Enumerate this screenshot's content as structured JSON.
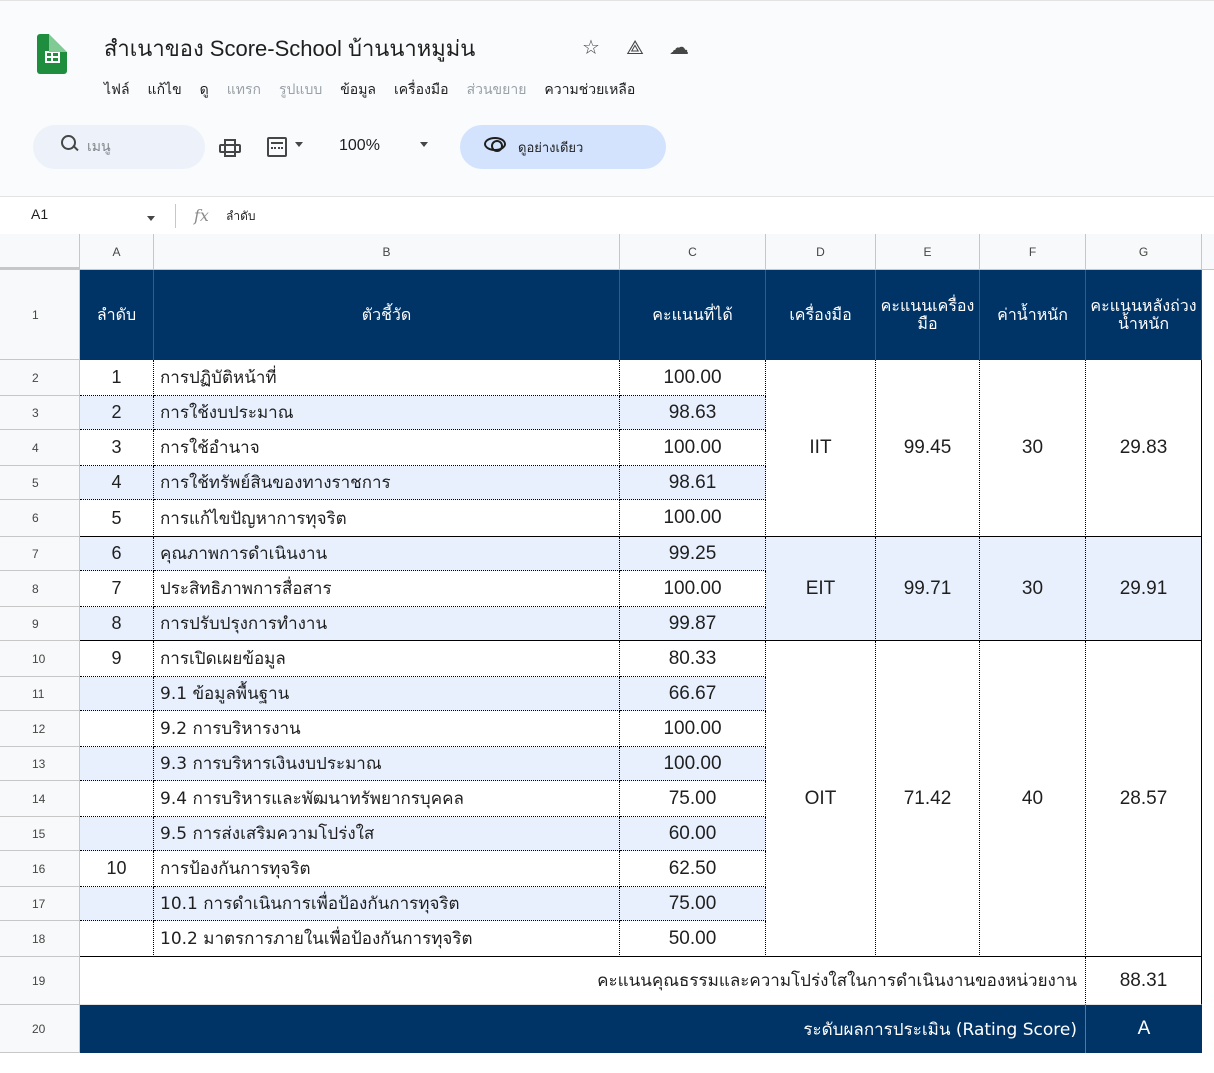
{
  "app": {
    "title": "สำเนาของ Score-School บ้านนาหมูม่น",
    "menu": [
      {
        "label": "ไฟล์",
        "enabled": true
      },
      {
        "label": "แก้ไข",
        "enabled": true
      },
      {
        "label": "ดู",
        "enabled": true
      },
      {
        "label": "แทรก",
        "enabled": false
      },
      {
        "label": "รูปแบบ",
        "enabled": false
      },
      {
        "label": "ข้อมูล",
        "enabled": true
      },
      {
        "label": "เครื่องมือ",
        "enabled": true
      },
      {
        "label": "ส่วนขยาย",
        "enabled": false
      },
      {
        "label": "ความช่วยเหลือ",
        "enabled": true
      }
    ]
  },
  "toolbar": {
    "search_placeholder": "เมนู",
    "zoom": "100%",
    "preview_label": "ดูอย่างเดียว"
  },
  "formula_bar": {
    "cell_ref": "A1",
    "fx": "fx",
    "value": "ลำดับ"
  },
  "columns": [
    "A",
    "B",
    "C",
    "D",
    "E",
    "F",
    "G"
  ],
  "rows": [
    "1",
    "2",
    "3",
    "4",
    "5",
    "6",
    "7",
    "8",
    "9",
    "10",
    "11",
    "12",
    "13",
    "14",
    "15",
    "16",
    "17",
    "18",
    "19",
    "20"
  ],
  "table": {
    "headers": [
      "ลำดับ",
      "ตัวชี้วัด",
      "คะแนนที่ได้",
      "เครื่องมือ",
      "คะแนนเครื่องมือ",
      "ค่าน้ำหนัก",
      "คะแนนหลังถ่วงน้ำหนัก"
    ],
    "rows": [
      {
        "no": "1",
        "indicator": "การปฏิบัติหน้าที่",
        "score": "100.00"
      },
      {
        "no": "2",
        "indicator": "การใช้งบประมาณ",
        "score": "98.63"
      },
      {
        "no": "3",
        "indicator": "การใช้อำนาจ",
        "score": "100.00"
      },
      {
        "no": "4",
        "indicator": "การใช้ทรัพย์สินของทางราชการ",
        "score": "98.61"
      },
      {
        "no": "5",
        "indicator": "การแก้ไขปัญหาการทุจริต",
        "score": "100.00"
      },
      {
        "no": "6",
        "indicator": "คุณภาพการดำเนินงาน",
        "score": "99.25"
      },
      {
        "no": "7",
        "indicator": "ประสิทธิภาพการสื่อสาร",
        "score": "100.00"
      },
      {
        "no": "8",
        "indicator": "การปรับปรุงการทำงาน",
        "score": "99.87"
      },
      {
        "no": "9",
        "indicator": "การเปิดเผยข้อมูล",
        "score": "80.33"
      },
      {
        "no": "",
        "indicator": "9.1 ข้อมูลพื้นฐาน",
        "score": "66.67"
      },
      {
        "no": "",
        "indicator": "9.2 การบริหารงาน",
        "score": "100.00"
      },
      {
        "no": "",
        "indicator": "9.3 การบริหารเงินงบประมาณ",
        "score": "100.00"
      },
      {
        "no": "",
        "indicator": "9.4 การบริหารและพัฒนาทรัพยากรบุคคล",
        "score": "75.00"
      },
      {
        "no": "",
        "indicator": "9.5 การส่งเสริมความโปร่งใส",
        "score": "60.00"
      },
      {
        "no": "10",
        "indicator": "การป้องกันการทุจริต",
        "score": "62.50"
      },
      {
        "no": "",
        "indicator": "10.1 การดำเนินการเพื่อป้องกันการทุจริต",
        "score": "75.00"
      },
      {
        "no": "",
        "indicator": "10.2 มาตรการภายในเพื่อป้องกันการทุจริต",
        "score": "50.00"
      }
    ],
    "tools": [
      {
        "tool": "IIT",
        "tool_score": "99.45",
        "weight": "30",
        "weighted": "29.83"
      },
      {
        "tool": "EIT",
        "tool_score": "99.71",
        "weight": "30",
        "weighted": "29.91"
      },
      {
        "tool": "OIT",
        "tool_score": "71.42",
        "weight": "40",
        "weighted": "28.57"
      }
    ],
    "total_label": "คะแนนคุณธรรมและความโปร่งใสในการดำเนินงานของหน่วยงาน",
    "total_value": "88.31",
    "rating_label": "ระดับผลการประเมิน (Rating Score)",
    "rating_value": "A"
  },
  "colors": {
    "header_bg": "#003366",
    "band_bg": "#e8f0fe",
    "app_green": "#1e8e3e",
    "preview_bg": "#d3e3fd"
  },
  "icons": {
    "logo": "sheets-logo-icon",
    "star": "star-icon",
    "drive": "move-to-drive-icon",
    "cloud": "cloud-saved-icon",
    "search": "search-icon",
    "print": "print-icon",
    "format": "number-format-icon",
    "eye": "eye-icon"
  }
}
